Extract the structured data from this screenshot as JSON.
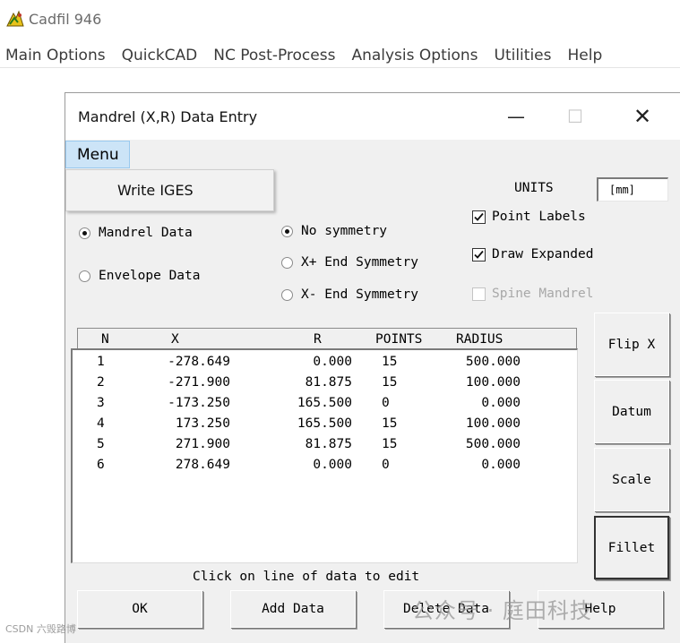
{
  "app": {
    "title": "Cadfil 946",
    "icon": "cadfil-logo-icon"
  },
  "menubar": [
    "Main Options",
    "QuickCAD",
    "NC Post-Process",
    "Analysis Options",
    "Utilities",
    "Help"
  ],
  "dialog": {
    "title": "Mandrel (X,R) Data Entry",
    "controls": {
      "minimize": "—",
      "maximize": "☐",
      "close": "✕"
    },
    "menu_label": "Menu",
    "dropdown_items": [
      "Write IGES"
    ],
    "units_label": "UNITS",
    "units_value": "[mm]",
    "data_type": {
      "mandrel": "Mandrel Data",
      "envelope": "Envelope Data",
      "selected": "Mandrel Data"
    },
    "symmetry": {
      "none": "No symmetry",
      "xplus": "X+ End Symmetry",
      "xminus": "X- End Symmetry",
      "selected": "No symmetry"
    },
    "checkboxes": {
      "point_labels": {
        "label": "Point Labels",
        "checked": true
      },
      "draw_expanded": {
        "label": "Draw Expanded",
        "checked": true
      },
      "spine_mandrel": {
        "label": "Spine Mandrel",
        "checked": false,
        "enabled": false
      }
    },
    "table": {
      "headers": {
        "n": "N",
        "x": "X",
        "r": "R",
        "points": "POINTS",
        "radius": "RADIUS"
      },
      "rows": [
        {
          "n": "1",
          "x": "-278.649",
          "r": "0.000",
          "points": "15",
          "radius": "500.000"
        },
        {
          "n": "2",
          "x": "-271.900",
          "r": "81.875",
          "points": "15",
          "radius": "100.000"
        },
        {
          "n": "3",
          "x": "-173.250",
          "r": "165.500",
          "points": "0",
          "radius": "0.000"
        },
        {
          "n": "4",
          "x": "173.250",
          "r": "165.500",
          "points": "15",
          "radius": "100.000"
        },
        {
          "n": "5",
          "x": "271.900",
          "r": "81.875",
          "points": "15",
          "radius": "500.000"
        },
        {
          "n": "6",
          "x": "278.649",
          "r": "0.000",
          "points": "0",
          "radius": "0.000"
        }
      ]
    },
    "hint": "Click on line of data to edit",
    "side_buttons": {
      "flip_x": "Flip X",
      "datum": "Datum",
      "scale": "Scale",
      "fillet": "Fillet"
    },
    "bottom_buttons": {
      "ok": "OK",
      "add_data": "Add Data",
      "delete_data": "Delete Data",
      "help": "Help"
    }
  },
  "watermark": "公众号 · 庭田科技",
  "corner_watermark": "CSDN 六毁路博"
}
